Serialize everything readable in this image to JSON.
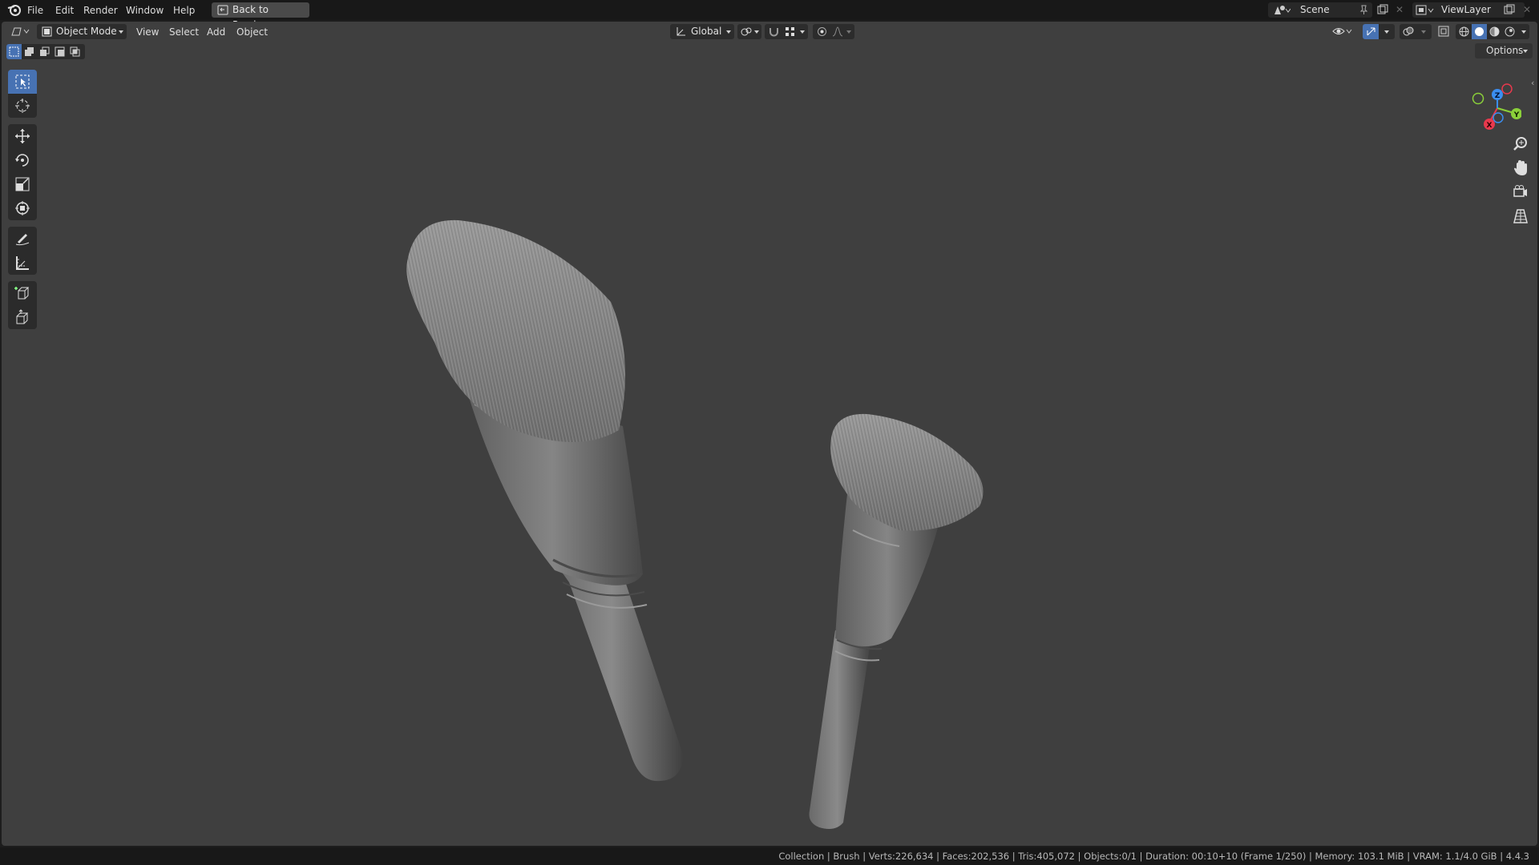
{
  "menu": {
    "file": "File",
    "edit": "Edit",
    "render": "Render",
    "window": "Window",
    "help": "Help",
    "back_to_previous": "Back to Previous"
  },
  "topbar_right": {
    "scene_label": "Scene",
    "view_layer_label": "ViewLayer"
  },
  "viewport_header": {
    "mode": "Object Mode",
    "view": "View",
    "select": "Select",
    "add": "Add",
    "object": "Object",
    "transform_orientation": "Global",
    "options": "Options"
  },
  "toolbar": {
    "tools": [
      "select-box",
      "cursor",
      "move",
      "rotate",
      "scale",
      "transform",
      "annotate",
      "measure",
      "add-cube",
      "extrude"
    ],
    "active_tool": "select-box"
  },
  "gizmo": {
    "axes": [
      "X",
      "Y",
      "Z"
    ],
    "colors": {
      "x": "#e8394d",
      "y": "#8bd03a",
      "z": "#3b8ef0",
      "neg": "#5a7a3a"
    }
  },
  "status": {
    "text": "Collection | Brush | Verts:226,634 | Faces:202,536 | Tris:405,072 | Objects:0/1 | Duration: 00:10+10 (Frame 1/250) | Memory: 103.1 MiB | VRAM: 1.1/4.0 GiB | 4.4.3"
  },
  "colors": {
    "accent": "#4772b3",
    "viewport_bg": "#3f3f3f",
    "header_bg": "#181818"
  }
}
